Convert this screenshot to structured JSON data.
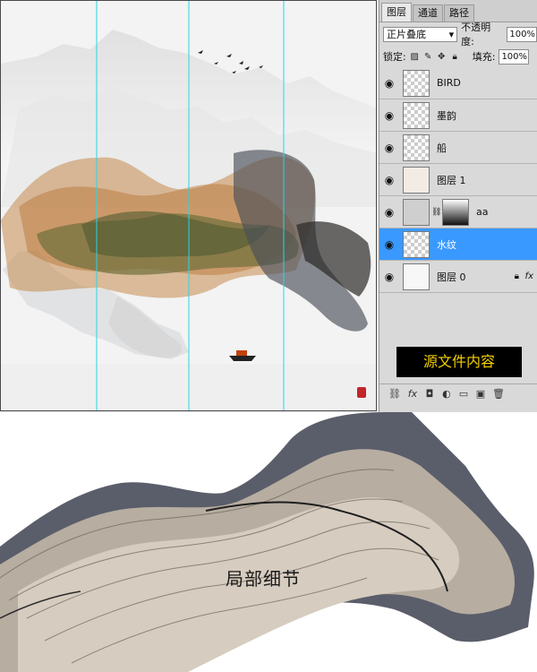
{
  "tabs": [
    "图层",
    "通道",
    "路径"
  ],
  "blend_mode": "正片叠底",
  "opacity_label": "不透明度:",
  "opacity_value": "100%",
  "lock_label": "锁定:",
  "fill_label": "填充:",
  "fill_value": "100%",
  "layers": [
    {
      "name": "BIRD",
      "selected": false
    },
    {
      "name": "墨韵",
      "selected": false
    },
    {
      "name": "船",
      "selected": false
    },
    {
      "name": "图层 1",
      "selected": false
    },
    {
      "name": "aa",
      "selected": false
    },
    {
      "name": "水纹",
      "selected": true
    },
    {
      "name": "图层 0",
      "selected": false
    }
  ],
  "source_label": "源文件内容",
  "detail_label": "局部细节",
  "colors": {
    "selection": "#3a99fe",
    "guide": "#26d6e6",
    "source_bg": "#000000",
    "source_text": "#f3d000"
  }
}
